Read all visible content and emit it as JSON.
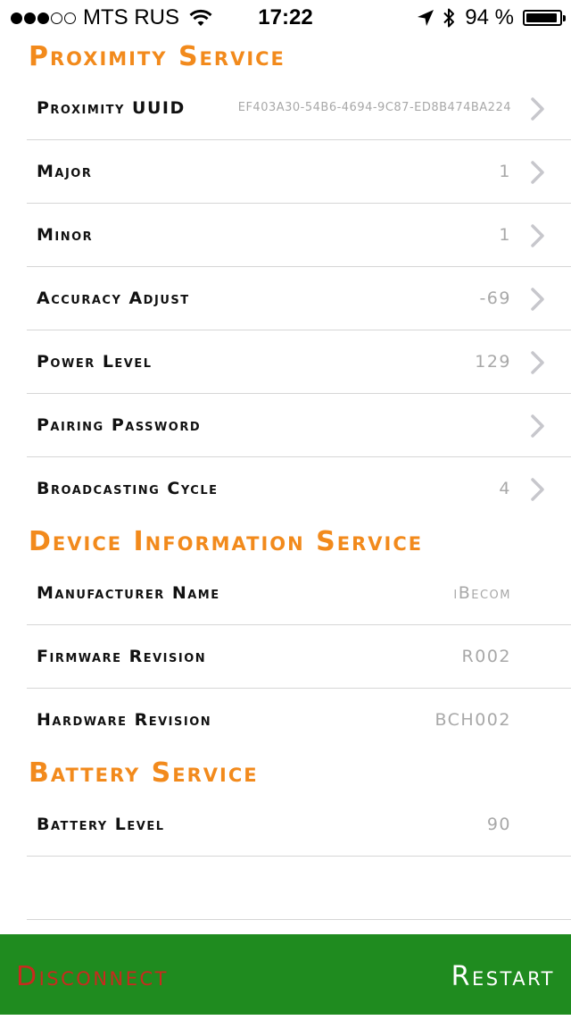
{
  "status_bar": {
    "carrier": "MTS RUS",
    "time": "17:22",
    "battery_percent_text": "94 %",
    "battery_level": 0.94,
    "signal_bars_filled": 3,
    "signal_bars_total": 5
  },
  "sections": {
    "proximity": {
      "title": "Proximity Service",
      "rows": [
        {
          "label": "Proximity UUID",
          "value": "EF403A30-54B6-4694-9C87-ED8B474BA224"
        },
        {
          "label": "Major",
          "value": "1"
        },
        {
          "label": "Minor",
          "value": "1"
        },
        {
          "label": "Accuracy Adjust",
          "value": "-69"
        },
        {
          "label": "Power Level",
          "value": "129"
        },
        {
          "label": "Pairing Password",
          "value": ""
        },
        {
          "label": "Broadcasting Cycle",
          "value": "4"
        }
      ]
    },
    "device_info": {
      "title": "Device Information Service",
      "rows": [
        {
          "label": "Manufacturer Name",
          "value": "iBecom"
        },
        {
          "label": "Firmware Revision",
          "value": "R002"
        },
        {
          "label": "Hardware Revision",
          "value": "BCH002"
        }
      ]
    },
    "battery": {
      "title": "Battery Service",
      "rows": [
        {
          "label": "Battery Level",
          "value": "90"
        }
      ]
    }
  },
  "bottom_bar": {
    "disconnect_label": "Disconnect",
    "restart_label": "Restart"
  },
  "colors": {
    "accent_orange": "#f28a1c",
    "bottom_bar_green": "#1f8b1f",
    "disconnect_red": "#c92a1e",
    "value_gray": "#a8a8a8",
    "divider": "#d6d6d6"
  },
  "icons": {
    "status": [
      "signal-dots-icon",
      "wifi-icon",
      "location-arrow-icon",
      "bluetooth-icon",
      "battery-icon"
    ],
    "row_disclosure": "chevron-right-icon"
  }
}
